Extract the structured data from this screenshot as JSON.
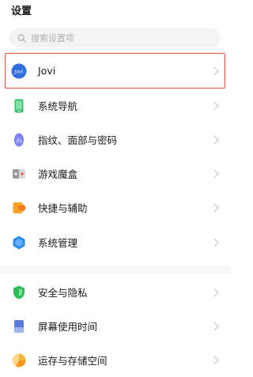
{
  "page": {
    "title": "设置"
  },
  "search": {
    "placeholder": "搜索设置项"
  },
  "items": [
    {
      "label": "Jovi",
      "icon": "jovi-icon",
      "icon_text": "Jovi"
    },
    {
      "label": "系统导航",
      "icon": "phone-navigation-icon"
    },
    {
      "label": "指纹、面部与密码",
      "icon": "fingerprint-icon"
    },
    {
      "label": "游戏魔盒",
      "icon": "game-box-icon"
    },
    {
      "label": "快捷与辅助",
      "icon": "shortcut-icon"
    },
    {
      "label": "系统管理",
      "icon": "system-management-icon"
    },
    {
      "label": "安全与隐私",
      "icon": "shield-icon"
    },
    {
      "label": "屏幕使用时间",
      "icon": "screen-time-icon"
    },
    {
      "label": "运存与存储空间",
      "icon": "storage-icon"
    }
  ],
  "colors": {
    "highlight": "#e24a3b",
    "jovi": "#2f6fe0",
    "navigation": "#34c26a",
    "fingerprint": "#7b83f0",
    "game": "#9a9a9a",
    "shortcut": "#f5a623",
    "system": "#2d8cf0",
    "security": "#2fbf5a",
    "screentime": "#5a7bd8",
    "storage": "#f4b33a"
  }
}
